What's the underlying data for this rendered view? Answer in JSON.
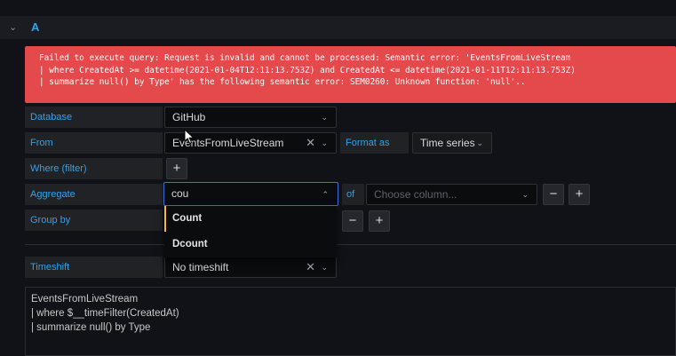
{
  "query": {
    "title": "A",
    "error": {
      "line1": "Failed to execute query: Request is invalid and cannot be processed: Semantic error: 'EventsFromLiveStream",
      "line2": "| where CreatedAt >= datetime(2021-01-04T12:11:13.753Z) and CreatedAt <= datetime(2021-01-11T12:11:13.753Z)",
      "line3": "| summarize null() by Type' has the following semantic error: SEM0260: Unknown function: 'null'.."
    },
    "database": {
      "label": "Database",
      "value": "GitHub"
    },
    "from": {
      "label": "From",
      "value": "EventsFromLiveStream"
    },
    "format": {
      "label": "Format as",
      "value": "Time series"
    },
    "where": {
      "label": "Where (filter)"
    },
    "aggregate": {
      "label": "Aggregate",
      "input_value": "cou",
      "of_label": "of",
      "column_placeholder": "Choose column...",
      "options": [
        "Count",
        "Dcount"
      ]
    },
    "group_by": {
      "label": "Group by"
    },
    "timeshift": {
      "label": "Timeshift",
      "value": "No timeshift"
    },
    "editor_lines": [
      "EventsFromLiveStream",
      "| where $__timeFilter(CreatedAt)",
      "| summarize null() by Type"
    ]
  },
  "icons": {
    "plus": "+",
    "minus": "−",
    "chevron_down": "⌄",
    "chevron_up": "⌃",
    "close": "✕",
    "collapse": "⌄"
  }
}
